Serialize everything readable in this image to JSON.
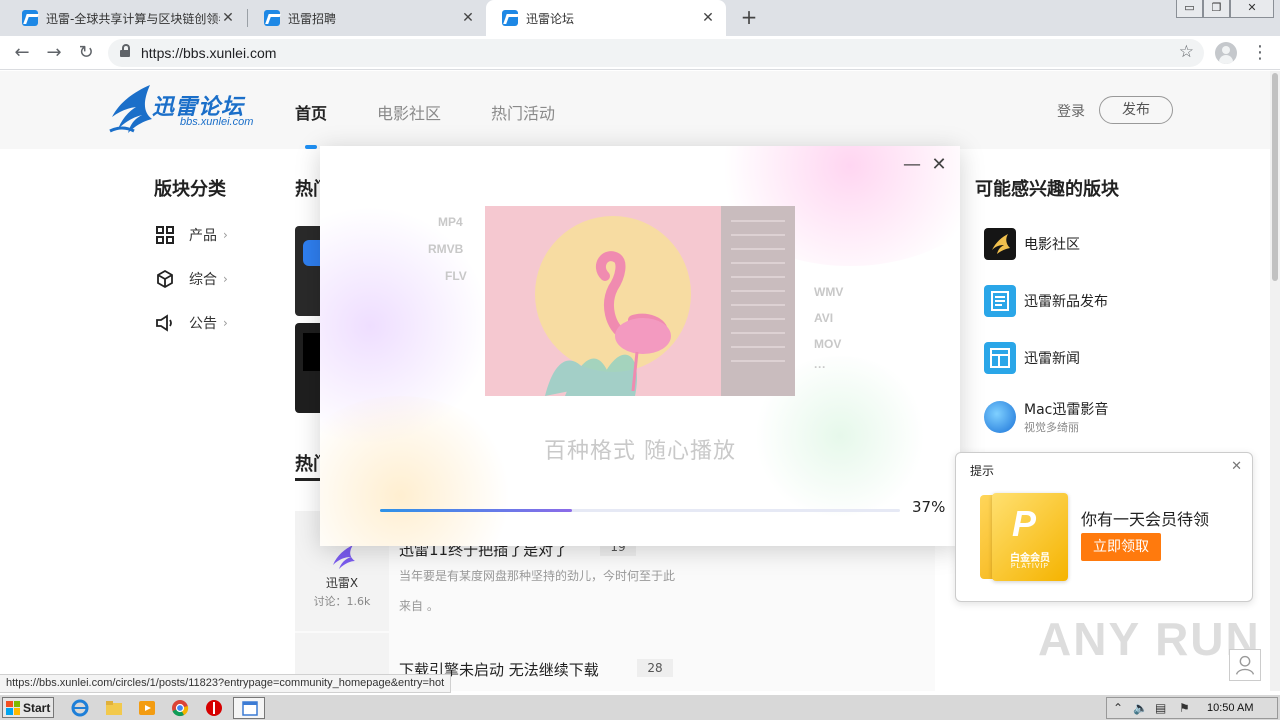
{
  "browser": {
    "tabs": [
      {
        "title": "迅雷-全球共享计算与区块链创领者",
        "active": false
      },
      {
        "title": "迅雷招聘",
        "active": false
      },
      {
        "title": "迅雷论坛",
        "active": true
      }
    ],
    "url": "https://bbs.xunlei.com",
    "window_buttons": [
      "▭",
      "❐",
      "✕"
    ]
  },
  "site": {
    "logo_text": "迅雷论坛",
    "logo_sub": "bbs.xunlei.com",
    "nav": [
      "首页",
      "电影社区",
      "热门活动"
    ],
    "login": "登录",
    "publish": "发布"
  },
  "left": {
    "title": "版块分类",
    "categories": [
      "产品",
      "综合",
      "公告"
    ]
  },
  "center": {
    "hot_title_1": "热门",
    "hot_title_2": "热门",
    "posts": [
      {
        "title": "迅雷11终于把插了是对了",
        "count": "19",
        "excerpt": "当年要是有某度网盘那种坚持的劲儿，今时何至于此",
        "source": "来自 。",
        "author": "迅雷X",
        "discuss": "讨论：1.6k"
      },
      {
        "title": "下载引擎未启动 无法继续下载",
        "count": "28"
      }
    ]
  },
  "right": {
    "title": "可能感兴趣的版块",
    "items": [
      {
        "name": "电影社区",
        "sub": ""
      },
      {
        "name": "迅雷新品发布",
        "sub": ""
      },
      {
        "name": "迅雷新闻",
        "sub": ""
      },
      {
        "name": "Mac迅雷影音",
        "sub": "视觉多绮丽"
      }
    ]
  },
  "popup": {
    "formats_left": [
      "MP4",
      "RMVB",
      "FLV"
    ],
    "formats_right": [
      "WMV",
      "AVI",
      "MOV",
      "···"
    ],
    "slogan": "百种格式 随心播放",
    "progress": 37,
    "progress_label": "37%",
    "minimize": "—",
    "close": "✕"
  },
  "notification": {
    "title": "提示",
    "close": "✕",
    "card_label": "白金会员",
    "card_label_en": "PLATIVIP",
    "card_letter": "P",
    "message": "你有一天会员待领",
    "button": "立即领取"
  },
  "status_url": "https://bbs.xunlei.com/circles/1/posts/11823?entrypage=community_homepage&entry=hot",
  "watermark": "ANY RUN",
  "taskbar": {
    "start": "Start",
    "clock": "10:50 AM"
  },
  "colors": {
    "accent": "#1f8ff2",
    "orange": "#ff7a0d",
    "gold": "#f5b300"
  }
}
